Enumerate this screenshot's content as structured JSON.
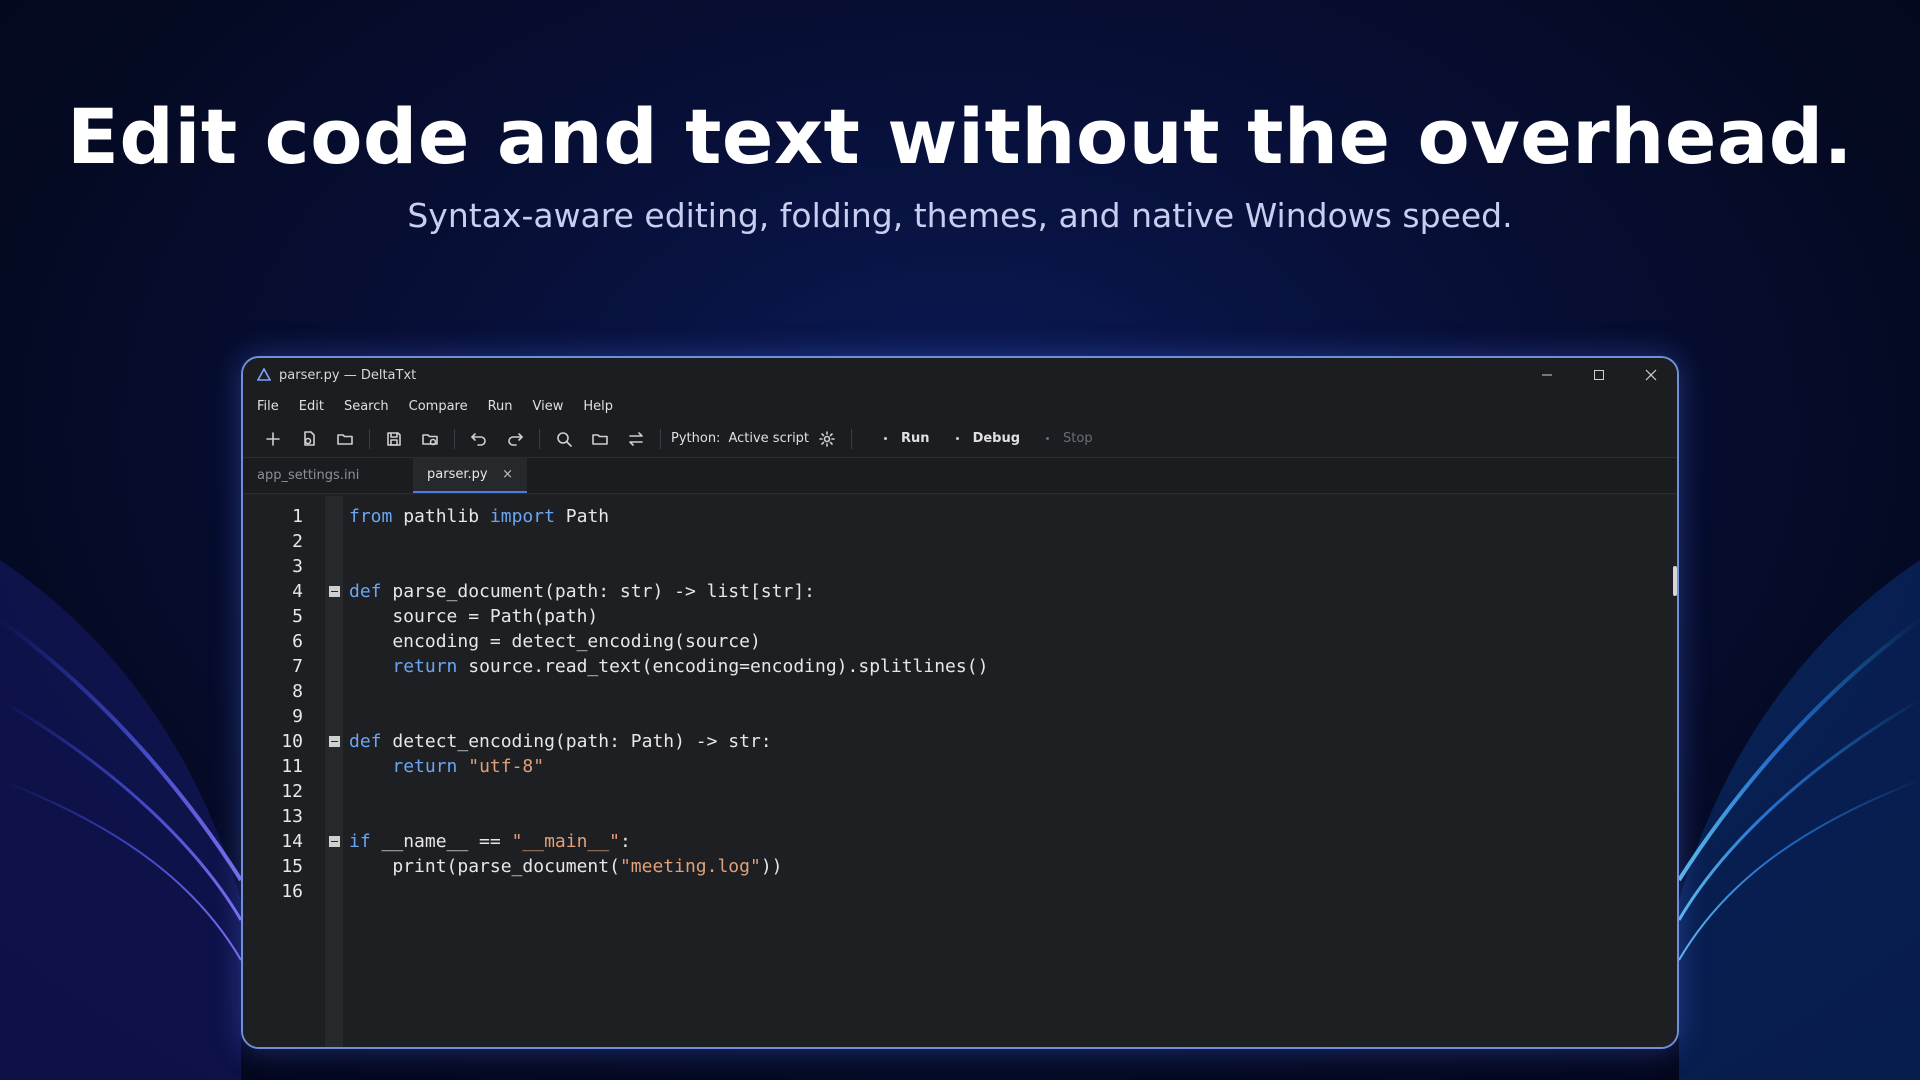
{
  "hero": {
    "headline": "Edit code and text without the overhead.",
    "subline": "Syntax-aware editing, folding, themes, and native Windows speed."
  },
  "window": {
    "title": "parser.py — DeltaTxt",
    "menu": [
      "File",
      "Edit",
      "Search",
      "Compare",
      "Run",
      "View",
      "Help"
    ],
    "toolbar": {
      "language_label": "Python:",
      "language_value": "Active script",
      "run_label": "Run",
      "debug_label": "Debug",
      "stop_label": "Stop"
    },
    "tabs": [
      {
        "label": "app_settings.ini",
        "active": false
      },
      {
        "label": "parser.py",
        "active": true,
        "close": "×"
      }
    ],
    "code_lines": [
      [
        [
          "kw",
          "from"
        ],
        [
          "t",
          " pathlib "
        ],
        [
          "kw",
          "import"
        ],
        [
          "t",
          " Path"
        ]
      ],
      [],
      [],
      [
        [
          "kw",
          "def"
        ],
        [
          "t",
          " parse_document(path: str) -> list[str]:"
        ]
      ],
      [
        [
          "t",
          "    source = Path(path)"
        ]
      ],
      [
        [
          "t",
          "    encoding = detect_encoding(source)"
        ]
      ],
      [
        [
          "t",
          "    "
        ],
        [
          "kw",
          "return"
        ],
        [
          "t",
          " source.read_text(encoding=encoding).splitlines()"
        ]
      ],
      [],
      [],
      [
        [
          "kw",
          "def"
        ],
        [
          "t",
          " detect_encoding(path: Path) -> str:"
        ]
      ],
      [
        [
          "t",
          "    "
        ],
        [
          "kw",
          "return"
        ],
        [
          "t",
          " "
        ],
        [
          "str",
          "\"utf-8\""
        ]
      ],
      [],
      [],
      [
        [
          "kw",
          "if"
        ],
        [
          "t",
          " __name__ == "
        ],
        [
          "str",
          "\"__main__\""
        ],
        [
          "t",
          ":"
        ]
      ],
      [
        [
          "t",
          "    print(parse_document("
        ],
        [
          "str",
          "\"meeting.log\""
        ],
        [
          "t",
          "))"
        ]
      ],
      []
    ],
    "line_numbers": [
      "1",
      "2",
      "3",
      "4",
      "5",
      "6",
      "7",
      "8",
      "9",
      "10",
      "11",
      "12",
      "13",
      "14",
      "15",
      "16"
    ],
    "fold_lines": [
      4,
      10,
      14
    ]
  },
  "colors": {
    "keyword": "#6aa6f2",
    "string": "#e0a07a",
    "accent": "#4d7de0"
  }
}
